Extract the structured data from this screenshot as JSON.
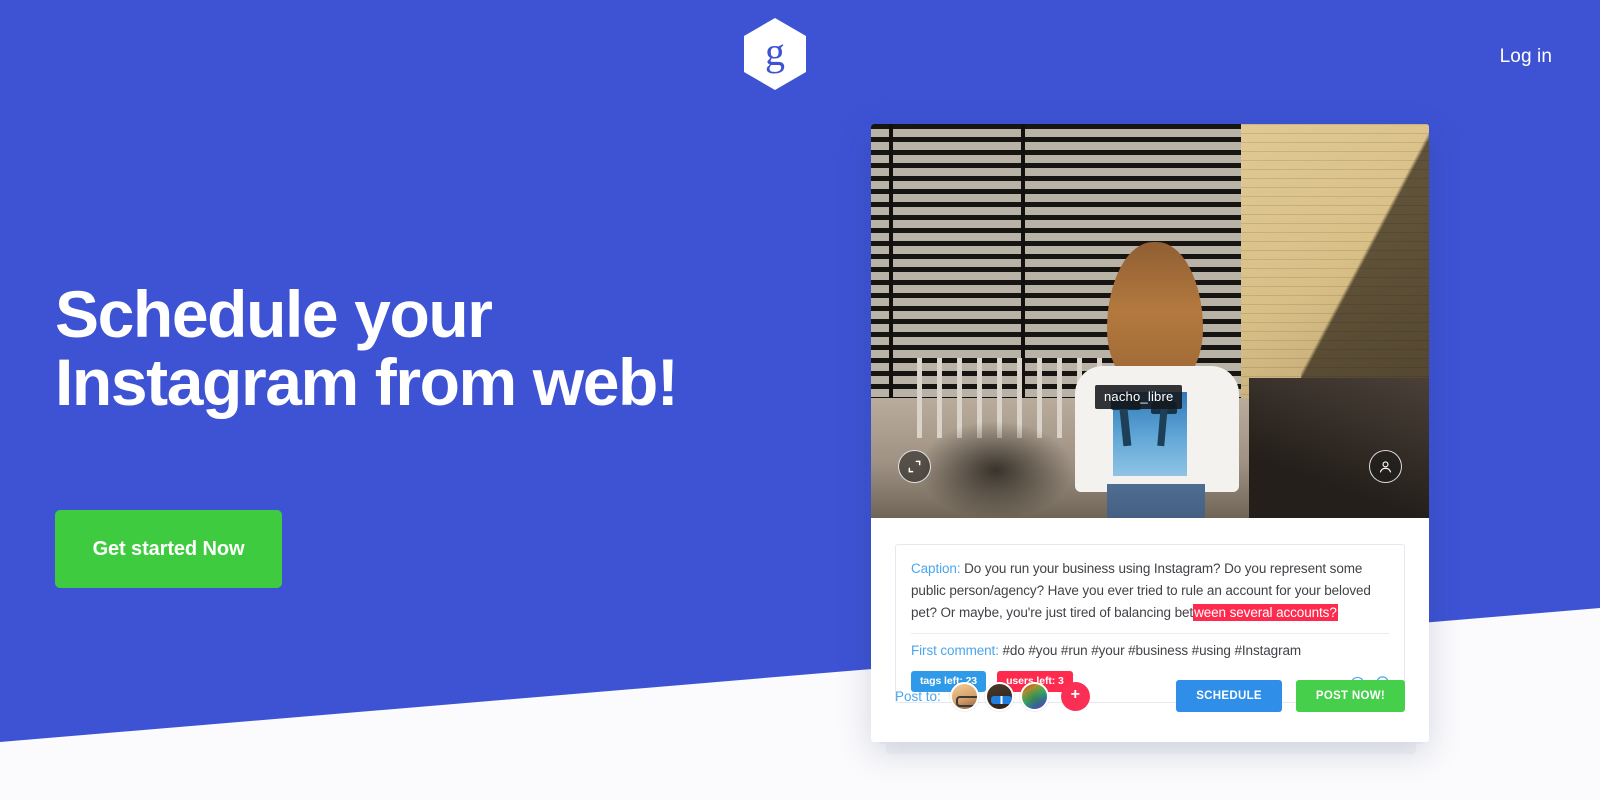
{
  "brand": {
    "logo_letter": "g",
    "logo_icon": "hexagon-logo",
    "accent_blue": "#3d53d4",
    "accent_green": "#3fcb3f",
    "accent_red": "#ff2b4f",
    "accent_lightblue": "#4aa6ef"
  },
  "nav": {
    "login_label": "Log in"
  },
  "hero": {
    "headline_line1": "Schedule your",
    "headline_line2": "Instagram from web!",
    "cta_label": "Get started Now"
  },
  "composer": {
    "photo": {
      "tag_label": "nacho_libre",
      "expand_icon": "fullscreen-icon",
      "tag_user_icon": "user-tag-icon"
    },
    "caption": {
      "label": "Caption:",
      "text_before": " Do you run your business using Instagram? Do you represent some public person/agency? Have you ever tried to rule an account for your beloved pet? Or maybe, you're just tired of balancing bet",
      "text_highlighted": "ween several accounts?"
    },
    "first_comment": {
      "label": "First comment:",
      "text": " #do #you #run #your #business #using #Instagram"
    },
    "badges": [
      {
        "label": "tags left: 23",
        "color": "#2f9ae8"
      },
      {
        "label": "users left: 3",
        "color": "#ff2b4f"
      }
    ],
    "caption_icons": [
      "comment-bubble-icon",
      "emoji-smiley-icon"
    ],
    "footer": {
      "post_to_label": "Post to:",
      "accounts": [
        {
          "name": "account-avatar-1"
        },
        {
          "name": "account-avatar-2"
        },
        {
          "name": "account-avatar-3"
        }
      ],
      "add_account_label": "+",
      "schedule_label": "SCHEDULE",
      "post_now_label": "POST NOW!"
    }
  }
}
